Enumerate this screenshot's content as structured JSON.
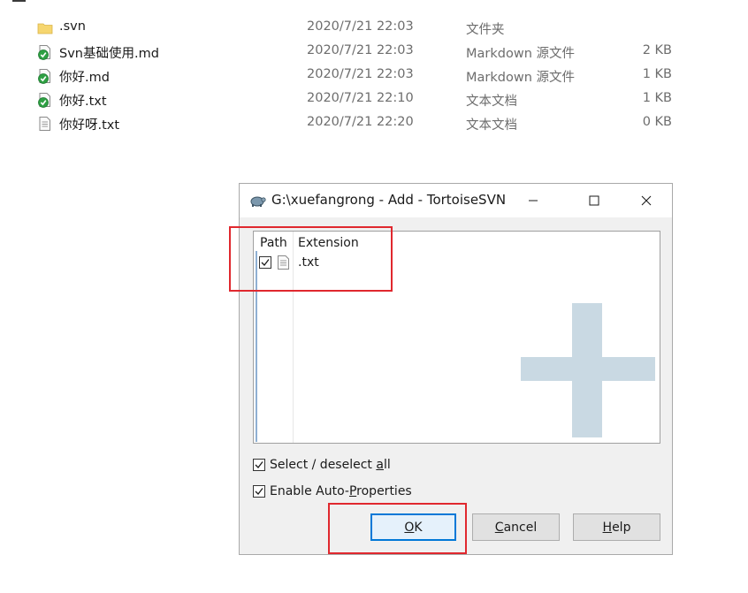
{
  "explorer": {
    "files": [
      {
        "icon": "folder-icon",
        "name": ".svn",
        "date": "2020/7/21 22:03",
        "type": "文件夹",
        "size": ""
      },
      {
        "icon": "svn-normal-overlay-icon",
        "name": "Svn基础使用.md",
        "date": "2020/7/21 22:03",
        "type": "Markdown 源文件",
        "size": "2 KB"
      },
      {
        "icon": "svn-normal-overlay-icon",
        "name": "你好.md",
        "date": "2020/7/21 22:03",
        "type": "Markdown 源文件",
        "size": "1 KB"
      },
      {
        "icon": "svn-normal-overlay-icon",
        "name": "你好.txt",
        "date": "2020/7/21 22:10",
        "type": "文本文档",
        "size": "1 KB"
      },
      {
        "icon": "text-file-icon",
        "name": "你好呀.txt",
        "date": "2020/7/21 22:20",
        "type": "文本文档",
        "size": "0 KB"
      }
    ]
  },
  "dialog": {
    "title": "G:\\xuefangrong - Add - TortoiseSVN",
    "list": {
      "col_path": "Path",
      "col_extension": "Extension",
      "rows": [
        {
          "checked": true,
          "extension": ".txt"
        }
      ]
    },
    "select_all": {
      "checked": true,
      "label_pre": "Select / deselect ",
      "label_accel": "a",
      "label_post": "ll"
    },
    "auto_props": {
      "checked": true,
      "label_pre": "Enable Auto-",
      "label_accel": "P",
      "label_post": "roperties"
    },
    "buttons": {
      "ok": {
        "accel": "O",
        "rest": "K"
      },
      "cancel": {
        "accel": "C",
        "rest": "ancel"
      },
      "help": {
        "accel": "H",
        "rest": "elp"
      }
    }
  },
  "colors": {
    "highlight_box": "#e0282e",
    "focus_button_border": "#0078d7",
    "svn_ok_green": "#2ea043",
    "watermark_plus": "#c9d9e3"
  }
}
